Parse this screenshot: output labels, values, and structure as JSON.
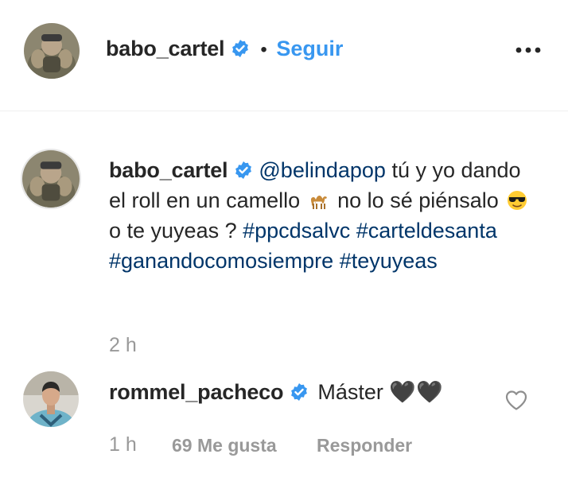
{
  "header": {
    "username": "babo_cartel",
    "separator": "•",
    "follow_label": "Seguir",
    "more_icon": "more-options-icon"
  },
  "caption": {
    "username": "babo_cartel",
    "mention": "@belindapop",
    "text_1": " tú y yo dando el roll en un camello ",
    "emoji_1": "camel-emoji",
    "text_2": " no lo sé piénsalo ",
    "emoji_2": "sunglasses-face-emoji",
    "text_3": " o te yuyeas ? ",
    "hashtags": [
      "#ppcdsalvc",
      "#carteldesanta",
      "#ganandocomosiempre",
      "#teyuyeas"
    ],
    "time": "2 h"
  },
  "comment": {
    "username": "rommel_pacheco",
    "text": "Máster 🖤🖤",
    "time": "1 h",
    "likes": "69 Me gusta",
    "reply_label": "Responder"
  },
  "colors": {
    "link": "#003569",
    "follow": "#3897f0",
    "verified": "#3897f0",
    "muted": "#999999"
  }
}
